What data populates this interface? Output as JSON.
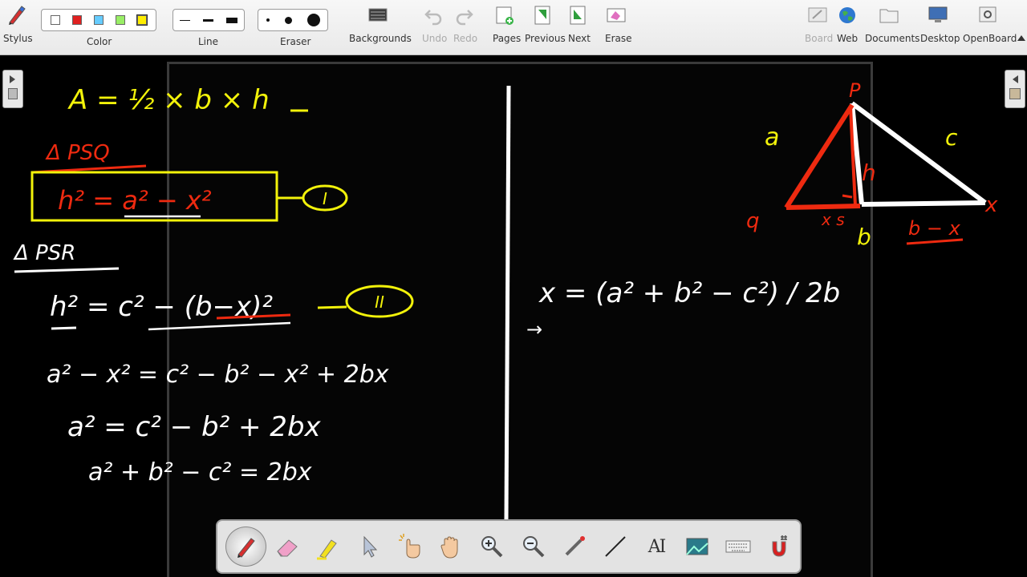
{
  "toolbar": {
    "stylus": "Stylus",
    "color": "Color",
    "line": "Line",
    "eraser": "Eraser",
    "backgrounds": "Backgrounds",
    "undo": "Undo",
    "redo": "Redo",
    "pages": "Pages",
    "previous": "Previous",
    "next": "Next",
    "erase": "Erase",
    "board": "Board",
    "web": "Web",
    "documents": "Documents",
    "desktop": "Desktop",
    "openboard": "OpenBoard"
  },
  "colors": {
    "swatches": [
      "#ffffff",
      "#e02020",
      "#66ccff",
      "#99ee66",
      "#ffee00"
    ],
    "ink_yellow": "#f2f20a",
    "ink_red": "#ee2a10",
    "ink_white": "#ffffff"
  },
  "board_ink": {
    "eq_area": "A = ½ × b × h",
    "label_psq": "Δ PSQ",
    "eq_h1": "h² = a² − x²",
    "label_1": "I",
    "label_psr": "Δ PSR",
    "eq_h2": "h² = c² − (b−x)²",
    "label_2": "II",
    "eq_step1": "a² − x² = c² − b² − x² + 2bx",
    "eq_step2": "a² = c² − b² + 2bx",
    "eq_step3": "a² + b² − c² = 2bx",
    "eq_x": "x = (a² + b² − c²) / 2b",
    "arrow": "→",
    "tri_P": "P",
    "tri_a": "a",
    "tri_c": "c",
    "tri_h": "h",
    "tri_q": "q",
    "tri_x": "x",
    "tri_xs": "x s",
    "tri_b": "b",
    "tri_bx": "b − x"
  },
  "palette": {
    "tools": [
      "pen-tool",
      "eraser-tool",
      "marker-tool",
      "selector-tool",
      "interactor-tool",
      "hand-tool",
      "zoom-in-tool",
      "zoom-out-tool",
      "laser-pointer-tool",
      "line-tool",
      "text-tool",
      "capture-tool",
      "virtual-keyboard-tool",
      "magnifier-tool"
    ],
    "text_tool_label": "AI"
  }
}
